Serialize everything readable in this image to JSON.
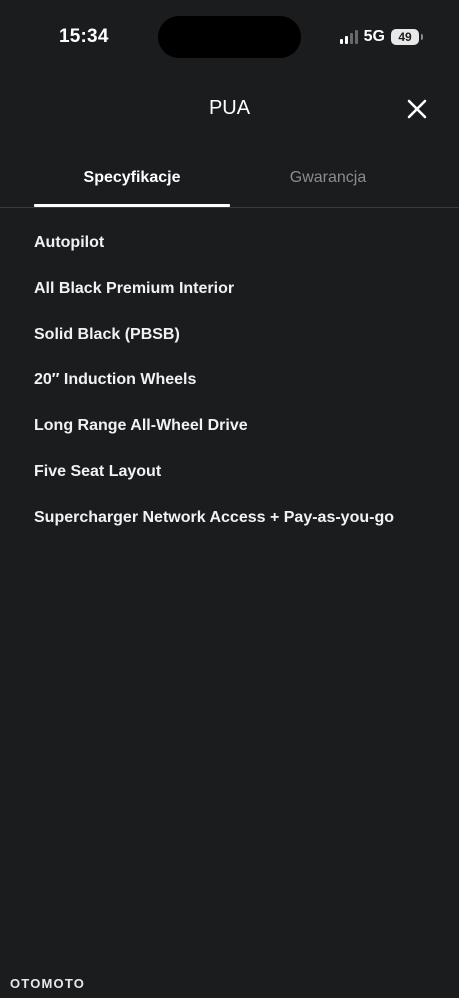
{
  "status_bar": {
    "time": "15:34",
    "network": "5G",
    "battery": "49"
  },
  "header": {
    "title": "PUA",
    "close_icon": "close-icon"
  },
  "tabs": [
    {
      "label": "Specyfikacje",
      "active": true
    },
    {
      "label": "Gwarancja",
      "active": false
    }
  ],
  "specs": [
    "Autopilot",
    "All Black Premium Interior",
    "Solid Black (PBSB)",
    "20′′ Induction Wheels",
    "Long Range All-Wheel Drive",
    "Five Seat Layout",
    "Supercharger Network Access + Pay-as-you-go"
  ],
  "watermark": "OTOMOTO",
  "colors": {
    "background": "#1b1c1e",
    "text": "#ffffff",
    "inactive_tab": "#8c8c90",
    "divider": "#3a3b3e"
  }
}
